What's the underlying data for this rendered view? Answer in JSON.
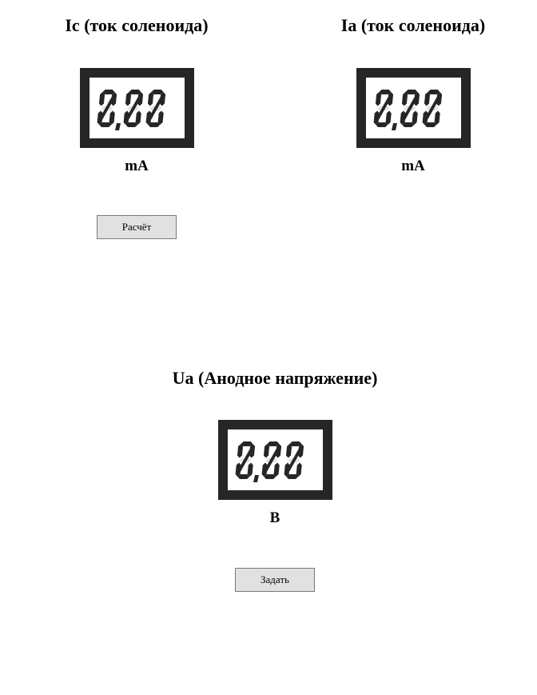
{
  "panels": {
    "ic": {
      "title": "Ic (ток соленоида)",
      "value": "0,00",
      "unit": "mA"
    },
    "ia": {
      "title": "Ia (ток соленоида)",
      "value": "0,00",
      "unit": "mA"
    },
    "ua": {
      "title": "Ua (Анодное напряжение)",
      "value": "0,00",
      "unit": "B"
    }
  },
  "buttons": {
    "calculate_label": "Расчёт",
    "set_label": "Задать"
  },
  "colors": {
    "segment_on": "#262626",
    "segment_off": "#e4e4e4",
    "display_frame": "#262626",
    "button_bg": "#e1e1e1",
    "button_border": "#7a7a7a"
  }
}
